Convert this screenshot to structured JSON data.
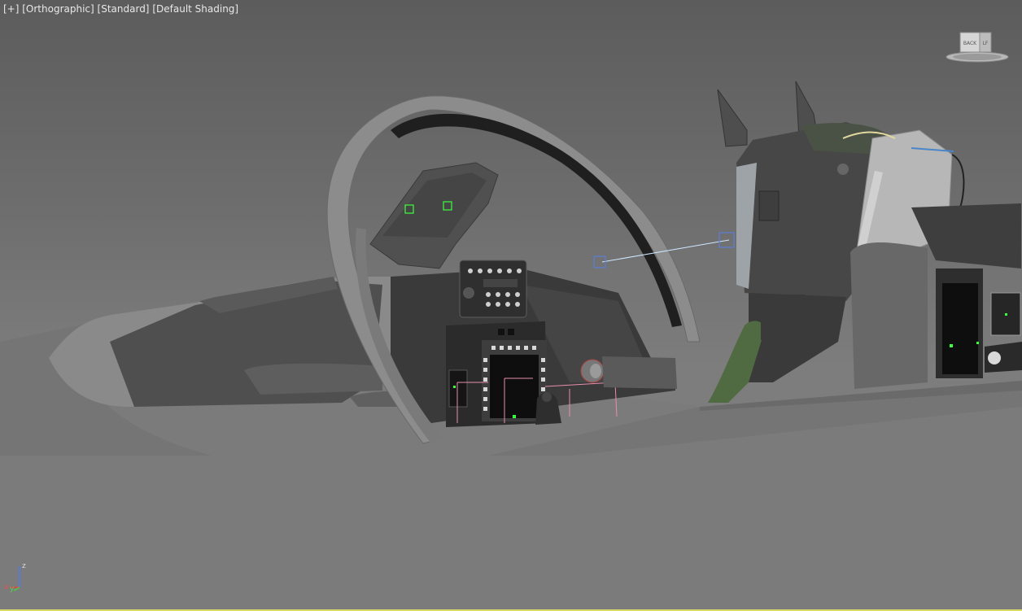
{
  "viewport": {
    "labels": {
      "maximize": "[+]",
      "view": "[Orthographic]",
      "camera": "[Standard]",
      "shading": "[Default Shading]"
    },
    "viewcube": {
      "face": "BACK",
      "side": "LF"
    },
    "axis": {
      "x": "x",
      "y": "y",
      "z": "z"
    }
  },
  "colors": {
    "background_top": "#5c5c5c",
    "background_bottom": "#7b7b7b",
    "label_text": "#e8e8e8",
    "selection_pink": "#e88fb0",
    "helper_green": "#3cff3c",
    "target_blue": "#5b7fd6",
    "active_border": "#d9d96a"
  },
  "icons": [
    "viewcube-icon",
    "axis-tripod-icon"
  ]
}
